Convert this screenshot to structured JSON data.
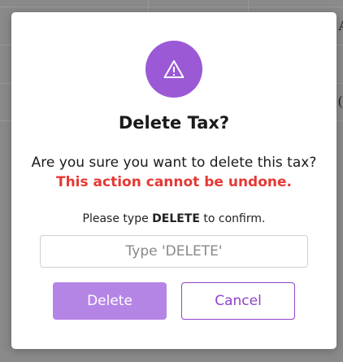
{
  "background": {
    "text_a": "A",
    "text_b": "(("
  },
  "dialog": {
    "icon": "warning-triangle-icon",
    "title": "Delete Tax?",
    "message": "Are you sure you want to delete this tax?",
    "warning": "This action cannot be undone.",
    "confirm_prefix": "Please type",
    "confirm_keyword": "DELETE",
    "confirm_suffix": "to confirm.",
    "input_placeholder": "Type 'DELETE'",
    "input_value": "",
    "delete_label": "Delete",
    "cancel_label": "Cancel"
  },
  "colors": {
    "accent": "#9b59d6",
    "delete_button": "#b585e6",
    "cancel_text": "#8e44c9",
    "warning_text": "#e53935"
  }
}
